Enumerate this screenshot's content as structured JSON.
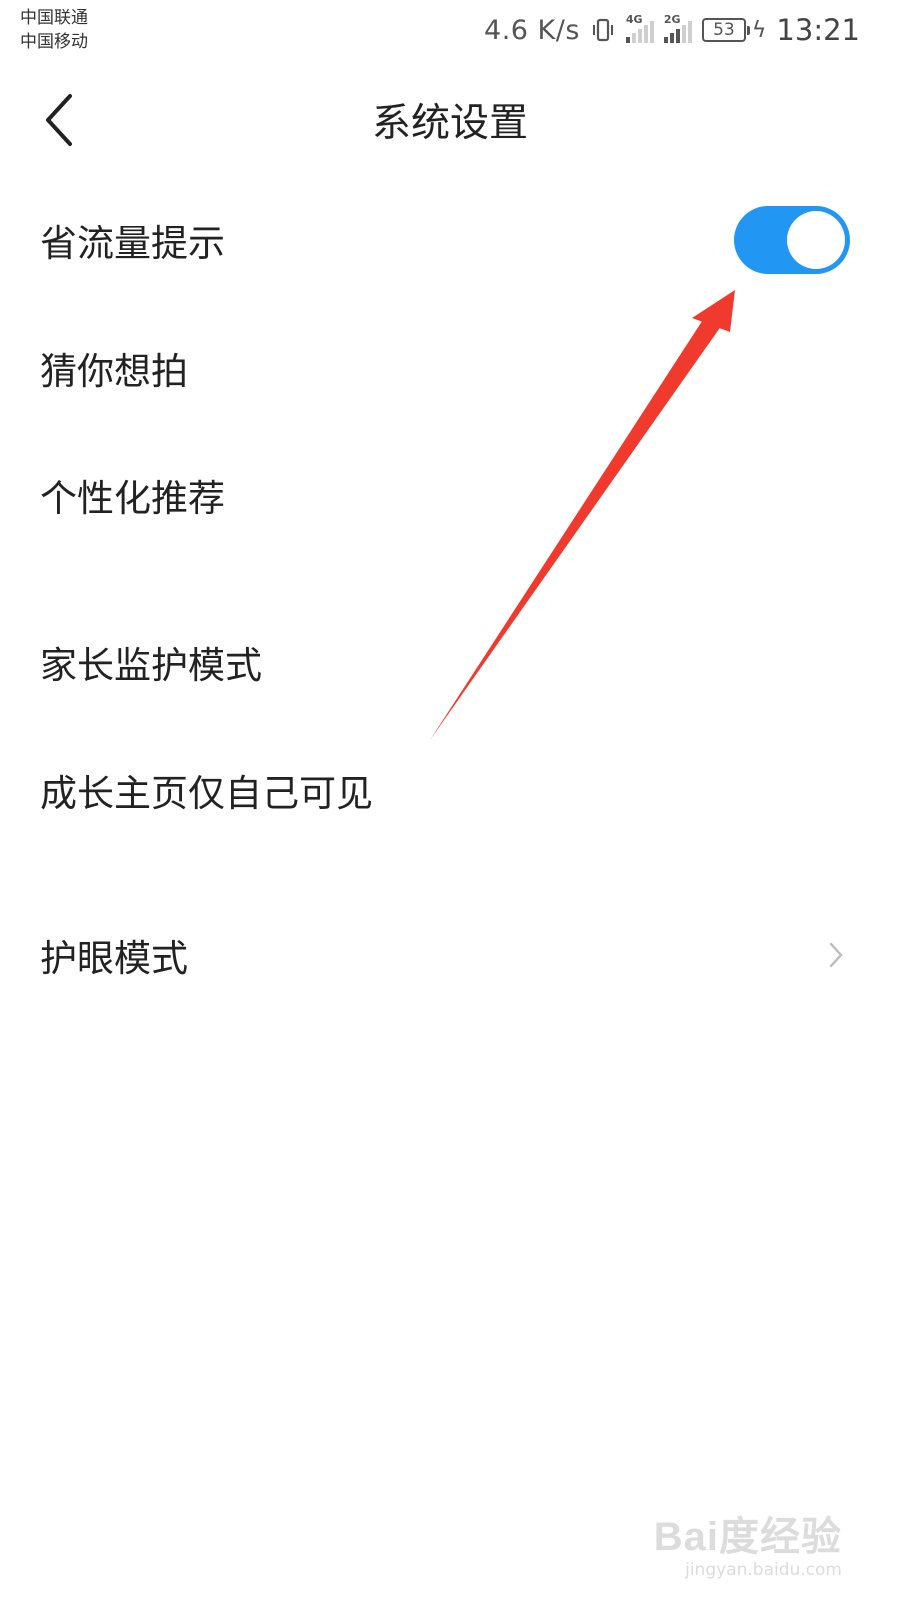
{
  "status_bar": {
    "carrier_1": "中国联通",
    "carrier_2": "中国移动",
    "net_speed": "4.6 K/s",
    "signal_1_label": "4G",
    "signal_2_label": "2G",
    "battery_level": "53",
    "time": "13:21"
  },
  "header": {
    "back_icon": "chevron-left-icon",
    "title": "系统设置"
  },
  "settings": [
    {
      "label": "省流量提示",
      "control": "toggle",
      "on": true
    },
    {
      "label": "猜你想拍",
      "control": "none"
    },
    {
      "label": "个性化推荐",
      "control": "none"
    },
    {
      "label": "家长监护模式",
      "control": "none"
    },
    {
      "label": "成长主页仅自己可见",
      "control": "none"
    },
    {
      "label": "护眼模式",
      "control": "chevron",
      "icon": "chevron-right-icon"
    }
  ],
  "colors": {
    "toggle_on": "#2196f3",
    "annotation_arrow": "#f03a2e"
  },
  "watermark": {
    "logo": "Bai度经验",
    "url": "jingyan.baidu.com"
  }
}
